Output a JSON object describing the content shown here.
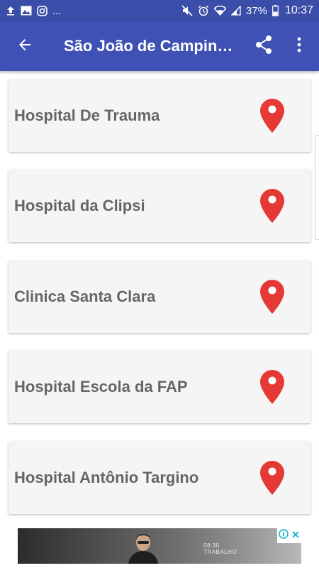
{
  "status_bar": {
    "time": "10:37",
    "battery_percent": "37%",
    "notification_more": "...",
    "left_icons": [
      "upload-icon",
      "image-icon",
      "instagram-icon"
    ],
    "right_icons": [
      "mute-icon",
      "alarm-icon",
      "wifi-icon",
      "signal-icon",
      "battery-icon"
    ]
  },
  "app_bar": {
    "title": "São João de Campinas",
    "background": "#3f51b5",
    "back_icon": "arrow-back-icon",
    "share_icon": "share-icon",
    "menu_icon": "more-vert-icon"
  },
  "hospitals": [
    {
      "name": "Hospital De Trauma",
      "icon": "map-pin-icon"
    },
    {
      "name": "Hospital da Clipsi",
      "icon": "map-pin-icon"
    },
    {
      "name": "Clinica Santa Clara",
      "icon": "map-pin-icon"
    },
    {
      "name": "Hospital Escola da FAP",
      "icon": "map-pin-icon"
    },
    {
      "name": "Hospital Antônio Targino",
      "icon": "map-pin-icon"
    }
  ],
  "pin_color": "#e53935",
  "ad": {
    "text_line1": "08:30",
    "text_line2": "TRABALHO",
    "icons": [
      "ad-info-icon",
      "ad-close-icon"
    ]
  }
}
